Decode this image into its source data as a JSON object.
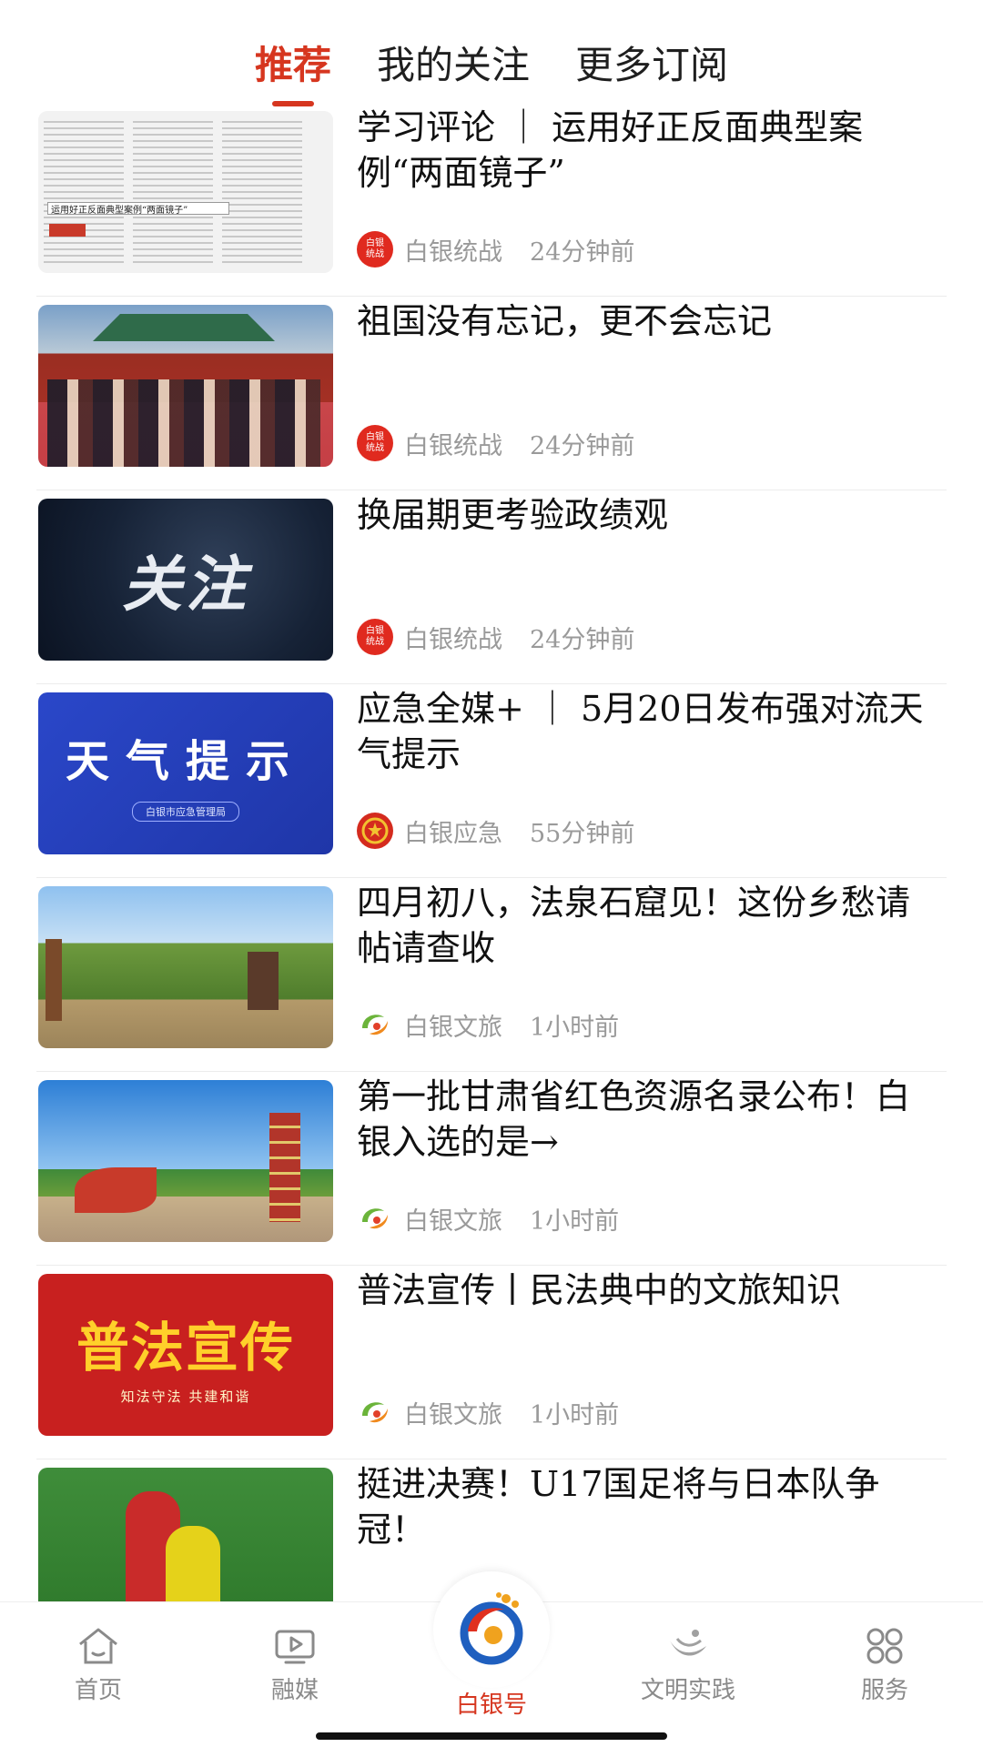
{
  "tabs": [
    "推荐",
    "我的关注",
    "更多订阅"
  ],
  "active_tab": 0,
  "feed": [
    {
      "title": "学习评论 ｜ 运用好正反面典型案例“两面镜子”",
      "source": "白银统战",
      "time": "24分钟前",
      "logo_text": "白银统战",
      "thumb_caption": "运用好正反面典型案例“两面镜子”"
    },
    {
      "title": "祖国没有忘记，更不会忘记",
      "source": "白银统战",
      "time": "24分钟前",
      "logo_text": "白银统战"
    },
    {
      "title": "换届期更考验政绩观",
      "source": "白银统战",
      "time": "24分钟前",
      "logo_text": "白银统战",
      "thumb_text": "关注"
    },
    {
      "title": "应急全媒+ ｜ 5月20日发布强对流天气提示",
      "source": "白银应急",
      "time": "55分钟前",
      "thumb_text": "天气提示",
      "thumb_sub": "白银市应急管理局"
    },
    {
      "title": "四月初八，法泉石窟见！这份乡愁请帖请查收",
      "source": "白银文旅",
      "time": "1小时前"
    },
    {
      "title": "第一批甘肃省红色资源名录公布！白银入选的是→",
      "source": "白银文旅",
      "time": "1小时前"
    },
    {
      "title": "普法宣传丨民法典中的文旅知识",
      "source": "白银文旅",
      "time": "1小时前",
      "thumb_text": "普法宣传",
      "thumb_sub": "知法守法 共建和谐"
    },
    {
      "title": "挺进决赛！U17国足将与日本队争冠！",
      "source": "",
      "time": ""
    }
  ],
  "nav": {
    "home": "首页",
    "media": "融媒",
    "center": "白银号",
    "civil": "文明实践",
    "service": "服务"
  },
  "colors": {
    "accent": "#d6361f",
    "muted": "#9a9a9a"
  }
}
